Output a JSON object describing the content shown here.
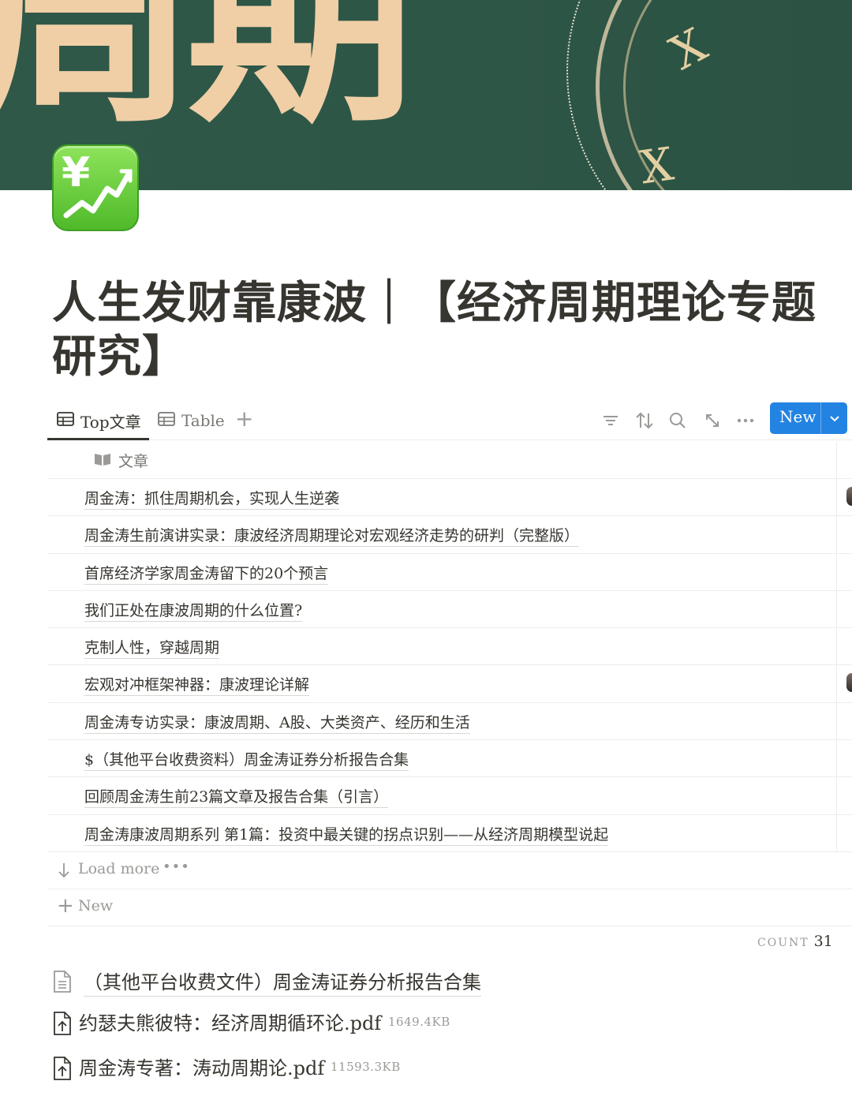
{
  "cover": {
    "text": "周期",
    "dial_numerals": [
      "X",
      "X"
    ]
  },
  "page": {
    "icon": "chart-increasing-with-yen-icon",
    "icon_text": "¥",
    "title": "人生发财靠康波｜【经济周期理论专题研究】"
  },
  "tabs": [
    {
      "label": "Top文章",
      "icon": "table-icon",
      "active": true
    },
    {
      "label": "Table",
      "icon": "table-icon",
      "active": false
    }
  ],
  "toolbar": {
    "add_view": "+",
    "icons": [
      "filter-icon",
      "sort-icon",
      "search-icon",
      "expand-icon",
      "more-icon"
    ],
    "new_label": "New"
  },
  "table": {
    "column_header": "文章",
    "rows": [
      "周金涛：抓住周期机会，实现人生逆袭",
      "周金涛生前演讲实录：康波经济周期理论对宏观经济走势的研判（完整版）",
      "首席经济学家周金涛留下的20个预言",
      "我们正处在康波周期的什么位置?",
      "克制人性，穿越周期",
      "宏观对冲框架神器：康波理论详解",
      "周金涛专访实录：康波周期、A股、大类资产、经历和生活",
      "$（其他平台收费资料）周金涛证券分析报告合集",
      "回顾周金涛生前23篇文章及报告合集（引言）",
      "周金涛康波周期系列 第1篇：投资中最关键的拐点识别——从经济周期模型说起"
    ],
    "load_more": "Load more",
    "new_row": "New",
    "count_label": "COUNT",
    "count": "31"
  },
  "blocks": {
    "subpage": "（其他平台收费文件）周金涛证券分析报告合集",
    "files": [
      {
        "name": "约瑟夫熊彼特：经济周期循环论.pdf",
        "size": "1649.4KB"
      },
      {
        "name": "周金涛专著：涛动周期论.pdf",
        "size": "11593.3KB"
      }
    ]
  }
}
